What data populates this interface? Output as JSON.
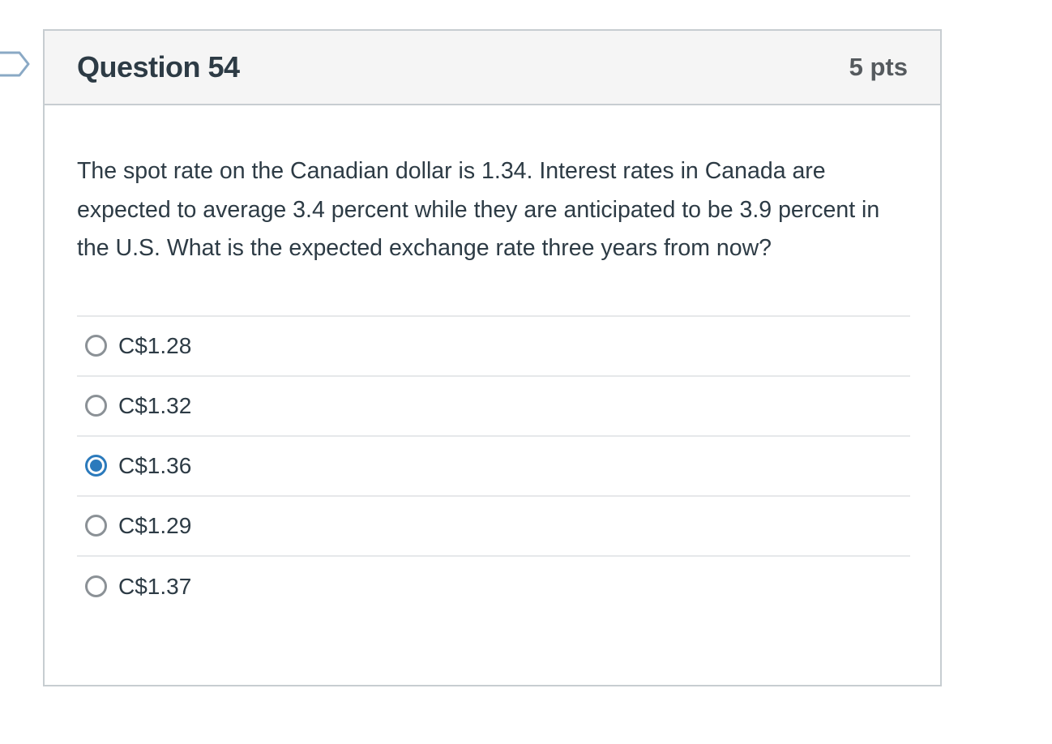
{
  "question": {
    "title": "Question 54",
    "points": "5 pts",
    "text": "The spot rate on the Canadian dollar is 1.34. Interest rates in Canada are expected to average 3.4 percent while they are anticipated to be 3.9 percent in the U.S. What is the expected exchange rate three years from now?"
  },
  "answers": [
    {
      "label": "C$1.28",
      "selected": false
    },
    {
      "label": "C$1.32",
      "selected": false
    },
    {
      "label": "C$1.36",
      "selected": true
    },
    {
      "label": "C$1.29",
      "selected": false
    },
    {
      "label": "C$1.37",
      "selected": false
    }
  ],
  "colors": {
    "accent": "#2b7abc",
    "header_bg": "#f5f5f5",
    "border": "#c7cdd1",
    "text": "#2d3b45"
  },
  "icons": {
    "flag_marker": "flag-marker-icon",
    "radio_unselected": "radio-unselected-icon",
    "radio_selected": "radio-selected-icon"
  }
}
